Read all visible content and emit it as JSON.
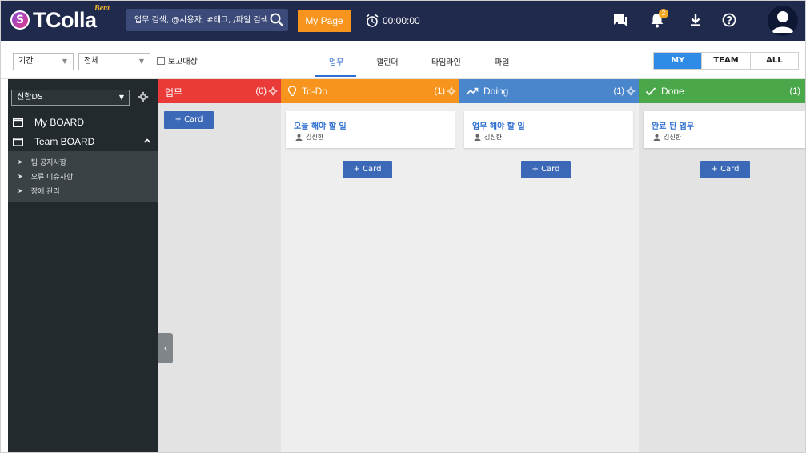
{
  "header": {
    "brand": "TColla",
    "brand_badge": "Beta",
    "logo_letter": "S",
    "search_placeholder": "업무 검색, @사용자, #태그, /파일 검색",
    "mypage_label": "My Page",
    "timer": "00:00:00",
    "notification_count": "2",
    "icons": [
      "search-icon",
      "alarm-clock-icon",
      "chat-icon",
      "bell-icon",
      "download-icon",
      "help-icon",
      "avatar-icon"
    ]
  },
  "toolbar": {
    "period_select": "기간",
    "scope_select": "전체",
    "report_label": "보고대상",
    "tabs": [
      {
        "label": "업무",
        "active": true
      },
      {
        "label": "캘린더",
        "active": false
      },
      {
        "label": "타임라인",
        "active": false
      },
      {
        "label": "파일",
        "active": false
      }
    ],
    "view_toggle": [
      {
        "label": "MY",
        "active": true
      },
      {
        "label": "TEAM",
        "active": false
      },
      {
        "label": "ALL",
        "active": false
      }
    ]
  },
  "sidebar": {
    "team_select": "신한DS",
    "items": [
      {
        "label": "My BOARD"
      },
      {
        "label": "Team BOARD"
      }
    ],
    "sub_items": [
      {
        "label": "팀 공지사항"
      },
      {
        "label": "오류 이슈사항"
      },
      {
        "label": "장애 관리"
      }
    ]
  },
  "board": {
    "add_card_label": "+ Card",
    "columns": [
      {
        "title": "업무",
        "count": "(0)",
        "color": "#ea3b39",
        "cards": []
      },
      {
        "title": "To-Do",
        "count": "(1)",
        "color": "#f7941d",
        "icon": "lightbulb-icon",
        "cards": [
          {
            "title": "오늘 해야 할 일",
            "user": "김신한"
          }
        ]
      },
      {
        "title": "Doing",
        "count": "(1)",
        "color": "#4a86cc",
        "icon": "trend-icon",
        "cards": [
          {
            "title": "업무 해야 할 일",
            "user": "김신한"
          }
        ]
      },
      {
        "title": "Done",
        "count": "(1)",
        "color": "#4aa84a",
        "icon": "check-icon",
        "cards": [
          {
            "title": "완료 된 업무",
            "user": "김신한"
          }
        ]
      }
    ]
  },
  "colors": {
    "header_bg": "#1f2a4d",
    "accent_orange": "#f7941d",
    "accent_blue": "#2f8be6",
    "sidebar_bg": "#222a2e"
  }
}
